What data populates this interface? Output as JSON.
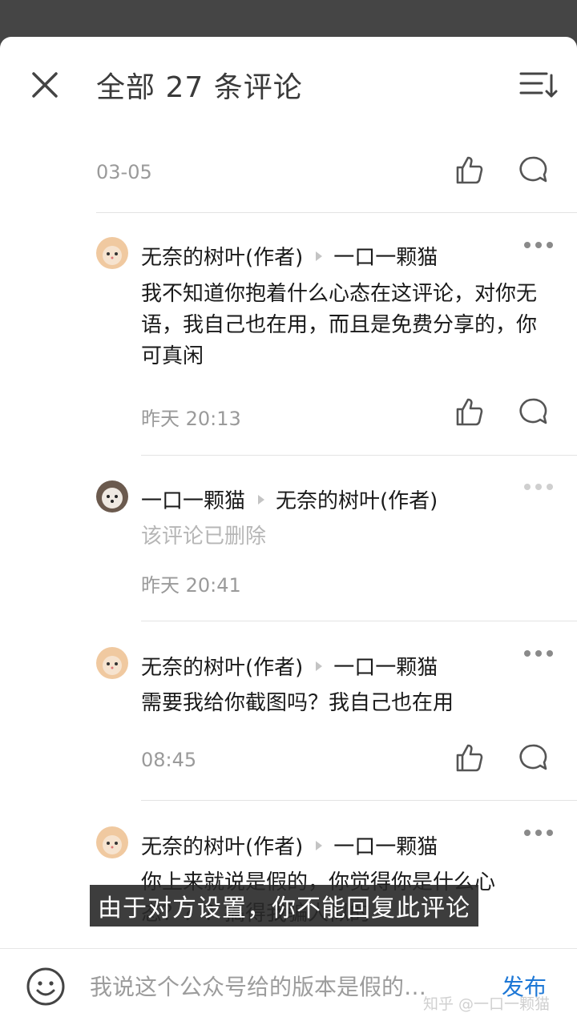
{
  "header": {
    "title": "全部 27 条评论",
    "close_icon": "close-icon",
    "sort_icon": "sort-icon"
  },
  "top_item": {
    "timestamp": "03-05"
  },
  "comments": [
    {
      "author": "无奈的树叶(作者)",
      "reply_to": "一口一颗猫",
      "text": "我不知道你抱着什么心态在这评论，对你无语，我自己也在用，而且是免费分享的，你可真闲",
      "timestamp": "昨天 20:13",
      "avatar": "cat-avatar"
    },
    {
      "author": "一口一颗猫",
      "reply_to": "无奈的树叶(作者)",
      "text": "该评论已删除",
      "timestamp": "昨天 20:41",
      "avatar": "dog-avatar"
    },
    {
      "author": "无奈的树叶(作者)",
      "reply_to": "一口一颗猫",
      "text": "需要我给你截图吗？我自己也在用",
      "timestamp": "08:45",
      "avatar": "cat-avatar"
    },
    {
      "author": "无奈的树叶(作者)",
      "reply_to": "一口一颗猫",
      "text": "你上来就说是假的，你觉得你是什么心态？？？搞得我骗人似的",
      "avatar": "cat-avatar"
    }
  ],
  "toast": "由于对方设置，你不能回复此评论",
  "footer": {
    "placeholder": "我说这个公众号给的版本是假的…",
    "send_label": "发布",
    "watermark": "知乎 @一口一颗猫"
  },
  "colors": {
    "accent": "#1e78d6",
    "muted": "#9a9a9a",
    "deleted": "#b6b6b6"
  }
}
